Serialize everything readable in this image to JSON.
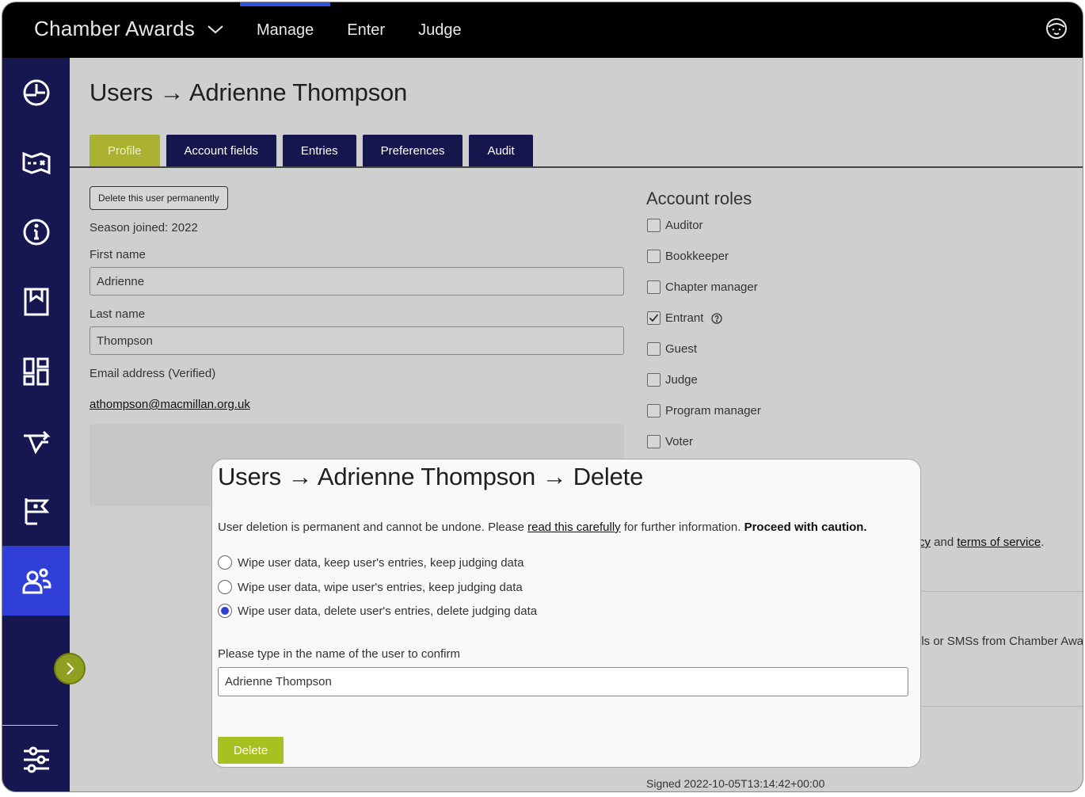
{
  "app": {
    "name": "Chamber Awards",
    "nav": [
      "Manage",
      "Enter",
      "Judge"
    ],
    "active_nav": "Manage"
  },
  "sidebar": {
    "items": [
      "dashboard-icon",
      "map-icon",
      "info-icon",
      "bookmark-icon",
      "grid-icon",
      "route-icon",
      "flag-icon",
      "users-icon"
    ],
    "active": "users-icon",
    "bottom": "sliders-icon"
  },
  "page": {
    "title": "Users → Adrienne Thompson",
    "tabs": [
      "Profile",
      "Account fields",
      "Entries",
      "Preferences",
      "Audit"
    ],
    "active_tab": "Profile"
  },
  "profile": {
    "delete_button": "Delete this user permanently",
    "season_joined": "Season joined: 2022",
    "first_name_label": "First name",
    "first_name_value": "Adrienne",
    "last_name_label": "Last name",
    "last_name_value": "Thompson",
    "email_label": "Email address (Verified)",
    "email_value": "athompson@macmillan.org.uk"
  },
  "roles": {
    "title": "Account roles",
    "items": [
      {
        "label": "Auditor",
        "checked": false
      },
      {
        "label": "Bookkeeper",
        "checked": false
      },
      {
        "label": "Chapter manager",
        "checked": false
      },
      {
        "label": "Entrant",
        "checked": true
      },
      {
        "label": "Guest",
        "checked": false
      },
      {
        "label": "Judge",
        "checked": false
      },
      {
        "label": "Program manager",
        "checked": false
      },
      {
        "label": "Voter",
        "checked": false
      }
    ]
  },
  "background": {
    "policy_fragment_link": "cy",
    "policy_and": "and",
    "terms_link": "terms of service",
    "policy_period": ".",
    "notifications_fragment": "ils or SMSs from Chamber Award",
    "signed": "Signed 2022-10-05T13:14:42+00:00"
  },
  "modal": {
    "title": "Users → Adrienne Thompson → Delete",
    "warn_pre": "User deletion is permanent and cannot be undone. Please",
    "warn_link": "read this carefully",
    "warn_mid": "for further information.",
    "warn_bold": "Proceed with caution.",
    "options": [
      "Wipe user data, keep user's entries, keep judging data",
      "Wipe user data, wipe user's entries, keep judging data",
      "Wipe user data, delete user's entries, delete judging data"
    ],
    "selected_option": 2,
    "confirm_label": "Please type in the name of the user to confirm",
    "confirm_value": "Adrienne Thompson",
    "delete_label": "Delete"
  },
  "colors": {
    "topbar": "#000000",
    "sidebar": "#161650",
    "sidebar_active": "#2f3fd8",
    "tab": "#16164f",
    "tab_active": "#aab030",
    "delete_button": "#a8c020"
  }
}
